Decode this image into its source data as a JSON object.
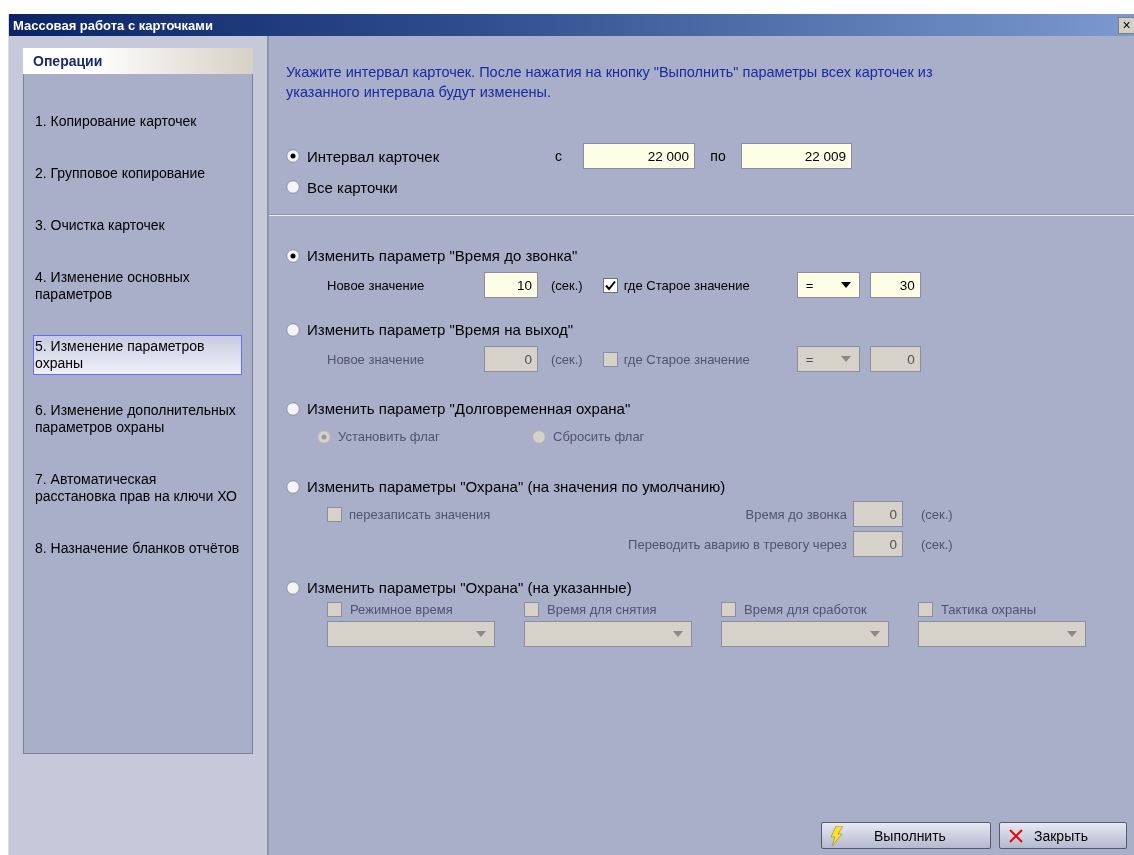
{
  "window": {
    "title": "Массовая работа с карточками",
    "close": "×"
  },
  "sidebar": {
    "header": "Операции",
    "items": [
      {
        "label": "1. Копирование карточек",
        "selected": false
      },
      {
        "label": "2. Групповое копирование",
        "selected": false
      },
      {
        "label": "3. Очистка карточек",
        "selected": false
      },
      {
        "label": "4. Изменение основных параметров",
        "selected": false
      },
      {
        "label": "5. Изменение параметров охраны",
        "selected": true
      },
      {
        "label": "6. Изменение дополнительных параметров охраны",
        "selected": false
      },
      {
        "label": "7. Автоматическая расстановка прав на ключи ХО",
        "selected": false
      },
      {
        "label": "8. Назначение бланков отчётов",
        "selected": false
      }
    ]
  },
  "intro": "Укажите интервал карточек. После нажатия на кнопку \"Выполнить\" параметры всех карточек из указанного интервала будут изменены.",
  "range": {
    "options": [
      {
        "label": "Интервал карточек",
        "selected": true,
        "from_label": "с",
        "from": "22 000",
        "to_label": "по",
        "to": "22 009"
      },
      {
        "label": "Все карточки",
        "selected": false
      }
    ]
  },
  "sections": [
    {
      "kind": "value",
      "label": "Изменить параметр \"Время до звонка\"",
      "selected": true,
      "disabled": false,
      "new_label": "Новое значение",
      "new_value": "10",
      "unit": "(сек.)",
      "condition": {
        "label": "где Старое значение",
        "checked": true,
        "operator": "=",
        "value": "30"
      }
    },
    {
      "kind": "value",
      "label": "Изменить параметр \"Время на выход\"",
      "selected": false,
      "disabled": true,
      "new_label": "Новое значение",
      "new_value": "0",
      "unit": "(сек.)",
      "condition": {
        "label": "где Старое значение",
        "checked": false,
        "operator": "=",
        "value": "0"
      }
    },
    {
      "kind": "flag",
      "label": "Изменить параметр \"Долговременная охрана\"",
      "selected": false,
      "disabled": true,
      "options": [
        {
          "label": "Установить флаг",
          "selected": true
        },
        {
          "label": "Сбросить флаг",
          "selected": false
        }
      ]
    },
    {
      "kind": "defaults",
      "label": "Изменить параметры \"Охрана\" (на значения по умолчанию)",
      "selected": false,
      "disabled": true,
      "overwrite": {
        "label": "перезаписать значения",
        "checked": false
      },
      "fields": [
        {
          "label": "Время до звонка",
          "value": "0",
          "unit": "(сек.)"
        },
        {
          "label": "Переводить аварию в тревогу через",
          "value": "0",
          "unit": "(сек.)"
        }
      ]
    },
    {
      "kind": "custom",
      "label": "Изменить параметры \"Охрана\" (на указанные)",
      "selected": false,
      "disabled": true,
      "columns": [
        {
          "label": "Режимное время",
          "checked": false
        },
        {
          "label": "Время для снятия",
          "checked": false
        },
        {
          "label": "Время для сработок",
          "checked": false
        },
        {
          "label": "Тактика охраны",
          "checked": false
        }
      ]
    }
  ],
  "buttons": [
    {
      "kind": "run",
      "label": "Выполнить"
    },
    {
      "kind": "close",
      "label": "Закрыть"
    }
  ]
}
